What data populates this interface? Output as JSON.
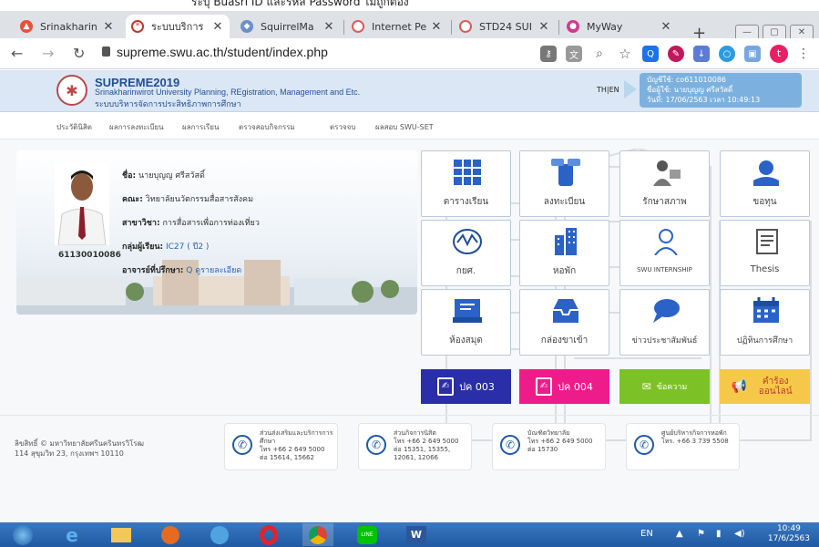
{
  "top_caption": "ระบุ Buasri ID และรหัส Password ไม่ถูกต้อง",
  "browser": {
    "tabs": [
      {
        "label": "Srinakharin",
        "icon": "a-icon",
        "active": false
      },
      {
        "label": "ระบบบริการ",
        "icon": "supreme-icon",
        "active": true
      },
      {
        "label": "SquirrelMa",
        "icon": "squirrel-icon",
        "active": false
      },
      {
        "label": "Internet Pe",
        "icon": "globe-icon",
        "active": false
      },
      {
        "label": "STD24 SUI",
        "icon": "globe-icon",
        "active": false
      },
      {
        "label": "MyWay",
        "icon": "myway-icon",
        "active": false
      }
    ],
    "new_tab": "+",
    "url": "supreme.swu.ac.th/student/index.php",
    "profile_initial": "t"
  },
  "header": {
    "system_name": "SUPREME2019",
    "system_desc": "Srinakharinwirot University Planning, REgistration, Management and Etc.",
    "system_desc_th": "ระบบบริหารจัดการประสิทธิภาพการศึกษา",
    "lang": "TH|EN",
    "user_line1": "บัญชีใช้: co611010086",
    "user_line2": "ชื่อผู้ใช้: นายบุญญ ศรีสวัสดิ์",
    "user_line3": "วันที่: 17/06/2563 เวลา 10:49:13"
  },
  "menu": [
    "ประวัตินิสิต",
    "ผลการลงทะเบียน",
    "ผลการเรียน",
    "ตรวจสอบกิจกรรม",
    "ตรวจจบ",
    "ผลสอบ SWU-SET"
  ],
  "student": {
    "id": "61130010086",
    "name_label": "ชื่อ:",
    "name": "นายบุญญ ศรีสวัสดิ์",
    "faculty_label": "คณะ:",
    "faculty": "วิทยาลัยนวัตกรรมสื่อสารสังคม",
    "major_label": "สาขาวิชา:",
    "major": "การสื่อสารเพื่อการท่องเที่ยว",
    "group_label": "กลุ่มผู้เรียน:",
    "group": "IC27 ( ปี2 )",
    "advisor_label": "อาจารย์ที่ปรึกษา:",
    "advisor": "Q ดูรายละเอียด"
  },
  "tiles": [
    {
      "label": "ตารางเรียน",
      "icon": "calendar-grid-icon"
    },
    {
      "label": "ลงทะเบียน",
      "icon": "phone-bill-icon"
    },
    {
      "label": "รักษาสภาพ",
      "icon": "handshake-icon"
    },
    {
      "label": "ขอทุน",
      "icon": "money-hand-icon"
    },
    {
      "label": "กยศ.",
      "icon": "kyo-logo-icon"
    },
    {
      "label": "หอพัก",
      "icon": "building-icon"
    },
    {
      "label": "SWU INTERNSHIP",
      "icon": "person-icon"
    },
    {
      "label": "Thesis",
      "icon": "document-icon"
    },
    {
      "label": "ห้องสมุด",
      "icon": "library-icon"
    },
    {
      "label": "กล่องขาเข้า",
      "icon": "inbox-icon"
    },
    {
      "label": "ข่าวประชาสัมพันธ์",
      "icon": "chat-icon"
    },
    {
      "label": "ปฏิทินการศึกษา",
      "icon": "calendar-icon"
    }
  ],
  "bottom_buttons": [
    {
      "label": "ปค 003",
      "color": "#2a2ea8"
    },
    {
      "label": "ปค 004",
      "color": "#ee1c8a"
    },
    {
      "label": "ข้อความ",
      "color": "#7cc227"
    },
    {
      "label": "คำร้องออนไลน์",
      "color": "#f6c84a"
    }
  ],
  "footer": {
    "copyright": "ลิขสิทธิ์ © มหาวิทยาลัยศรีนครินทรวิโรฒ",
    "address": "114 สุขุมวิท 23, กรุงเทพฯ 10110",
    "contacts": [
      {
        "title": "ส่วนส่งเสริมและบริการการศึกษา",
        "tel": "โทร +66 2 649 5000",
        "ext": "ต่อ 15614, 15662"
      },
      {
        "title": "ส่วนกิจการนิสิต",
        "tel": "โทร +66 2 649 5000",
        "ext": "ต่อ 15351, 15355, 12061, 12066"
      },
      {
        "title": "บัณฑิตวิทยาลัย",
        "tel": "โทร +66 2 649 5000",
        "ext": "ต่อ 15730"
      },
      {
        "title": "ศูนย์บริหารกิจการหอพัก",
        "tel": "โทร. +66 3 739 5508",
        "ext": ""
      }
    ]
  },
  "taskbar": {
    "lang": "EN",
    "time": "10:49",
    "date": "17/6/2563"
  }
}
